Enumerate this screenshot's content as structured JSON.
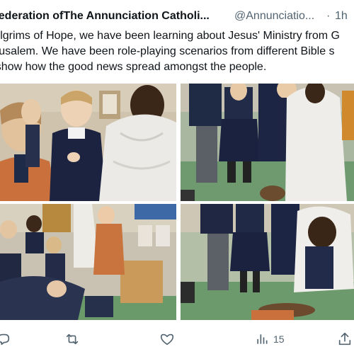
{
  "tweet": {
    "author_name": "Federation ofThe Annunciation Catholi...",
    "handle": "@Annunciatio...",
    "separator": "·",
    "time": "1h",
    "text_lines": [
      "Pilgrims of Hope, we have been learning about Jesus' Ministry from G",
      "Jerusalem. We have been role-playing scenarios from different Bible s",
      "to show how the good news spread amongst the people."
    ],
    "media": {
      "photos": [
        {
          "name": "photo-top-left",
          "description_icon": "photo-icon"
        },
        {
          "name": "photo-top-right",
          "description_icon": "photo-icon"
        },
        {
          "name": "photo-bottom-left",
          "description_icon": "photo-icon"
        },
        {
          "name": "photo-bottom-right",
          "description_icon": "photo-icon"
        }
      ]
    },
    "actions": {
      "reply_icon": "reply-icon",
      "retweet_icon": "retweet-icon",
      "like_icon": "heart-icon",
      "views_icon": "views-chart-icon",
      "views_count": "15",
      "share_icon": "share-icon"
    }
  },
  "colors": {
    "text": "#0f1419",
    "secondary": "#536471",
    "background": "#ffffff"
  }
}
